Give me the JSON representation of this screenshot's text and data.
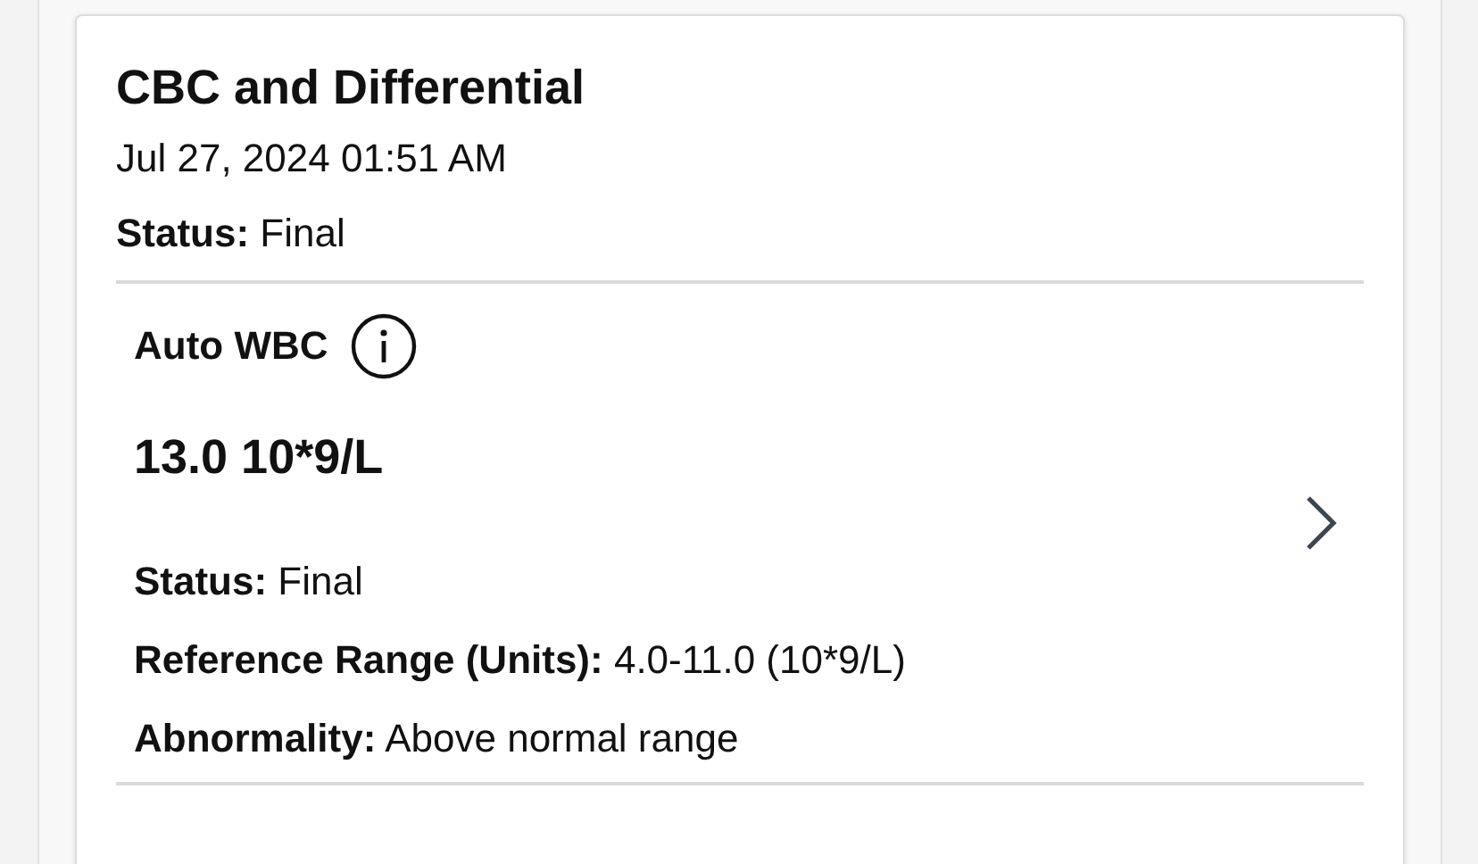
{
  "report": {
    "title": "CBC and Differential",
    "date": "Jul 27, 2024 01:51 AM",
    "status": "**Status:** Final"
  },
  "results": [
    {
      "name": "Auto WBC",
      "value": "13.0 10*9/L",
      "details": [
        "**Status:** Final",
        "**Reference Range (Units):** 4.0-11.0 (10*9/L)",
        "**Abnormality:** Above normal range"
      ]
    }
  ]
}
